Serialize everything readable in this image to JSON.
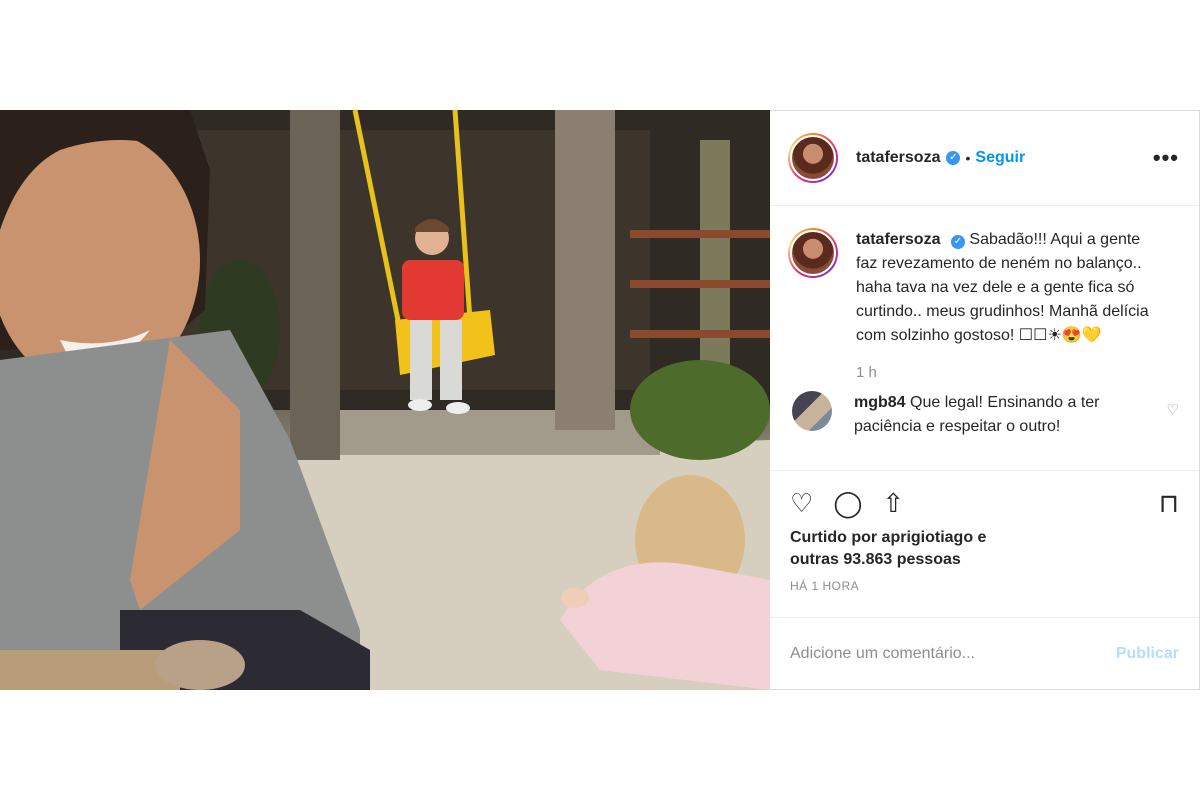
{
  "header": {
    "username": "tatafersoza",
    "verified_mark": "✓",
    "separator": "•",
    "follow_label": "Seguir",
    "more_label": "•••"
  },
  "caption": {
    "username": "tatafersoza",
    "text": "Sabadão!!! Aqui a gente faz revezamento de neném no balanço.. haha tava na vez dele e a gente fica só curtindo.. meus grudinhos! Manhã delícia com solzinho gostoso! ☐☐☀😍💛",
    "time": "1 h"
  },
  "comments": [
    {
      "username": "mgb84",
      "text": "Que legal! Ensinando a ter paciência e respeitar o outro!",
      "like_icon": "♡"
    }
  ],
  "actions": {
    "like_icon": "♡",
    "comment_icon": "◯",
    "share_icon": "⇧",
    "save_icon": "⊓"
  },
  "likes": {
    "line1": "Curtido por aprigiotiago e",
    "line2": "outras 93.863 pessoas"
  },
  "timestamp": "HÁ 1 HORA",
  "add_comment": {
    "placeholder": "Adicione um comentário...",
    "publish_label": "Publicar"
  },
  "colors": {
    "accent": "#0095f6",
    "verified": "#3897f0",
    "publish_disabled": "#b2dffc",
    "muted": "#8e8e8e"
  }
}
